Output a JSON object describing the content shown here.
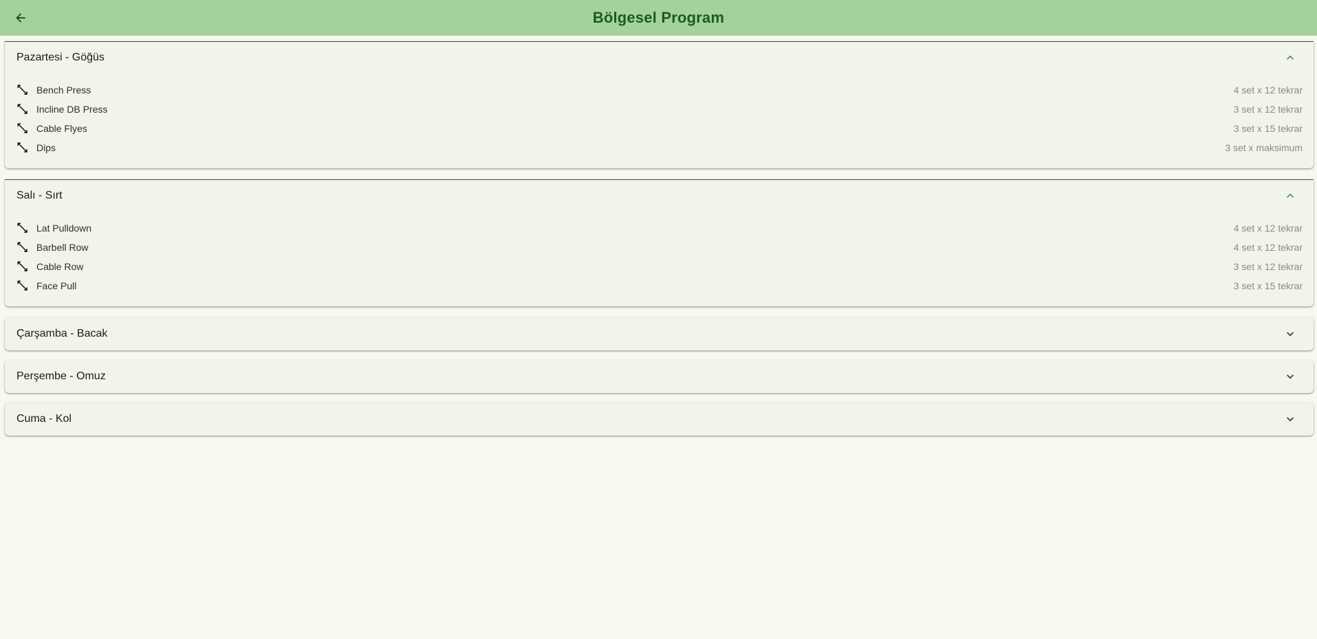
{
  "appbar": {
    "title": "Bölgesel Program",
    "title_color": "#1d5a22",
    "background": "#a3d39a",
    "back_icon": "arrow-left-icon"
  },
  "colors": {
    "page_bg": "#f6f9ef",
    "panel_bg": "#f1f4ea",
    "accent": "#3f9b43"
  },
  "panels": [
    {
      "title": "Pazartesi - Göğüs",
      "expanded": true,
      "exercises": [
        {
          "name": "Bench Press",
          "sets": "4 set x 12 tekrar"
        },
        {
          "name": "Incline DB Press",
          "sets": "3 set x 12 tekrar"
        },
        {
          "name": "Cable Flyes",
          "sets": "3 set x 15 tekrar"
        },
        {
          "name": "Dips",
          "sets": "3 set x maksimum"
        }
      ]
    },
    {
      "title": "Salı - Sırt",
      "expanded": true,
      "exercises": [
        {
          "name": "Lat Pulldown",
          "sets": "4 set x 12 tekrar"
        },
        {
          "name": "Barbell Row",
          "sets": "4 set x 12 tekrar"
        },
        {
          "name": "Cable Row",
          "sets": "3 set x 12 tekrar"
        },
        {
          "name": "Face Pull",
          "sets": "3 set x 15 tekrar"
        }
      ]
    },
    {
      "title": "Çarşamba - Bacak",
      "expanded": false,
      "exercises": []
    },
    {
      "title": "Perşembe - Omuz",
      "expanded": false,
      "exercises": []
    },
    {
      "title": "Cuma - Kol",
      "expanded": false,
      "exercises": []
    }
  ]
}
